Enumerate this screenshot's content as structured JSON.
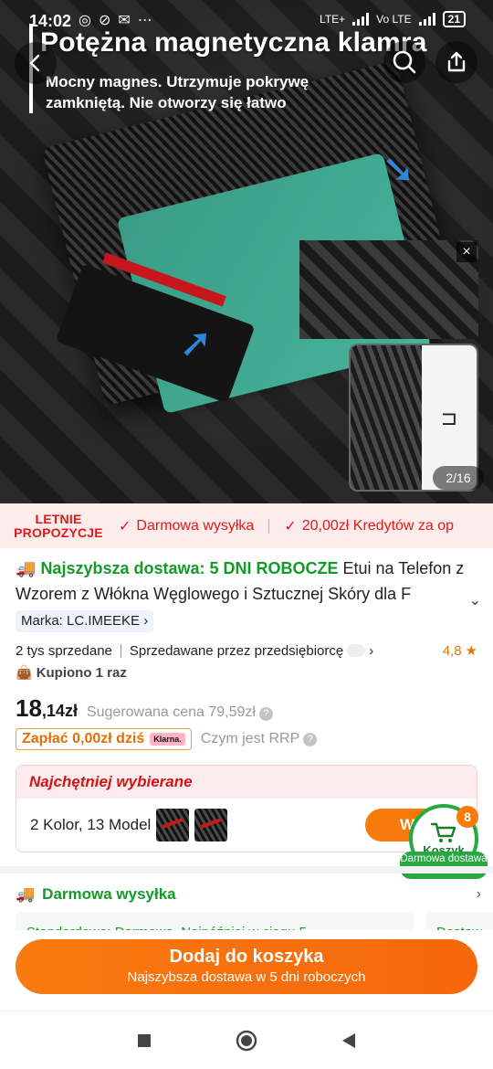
{
  "status_bar": {
    "time": "14:02",
    "battery": "21",
    "net_labels": [
      "LTE+",
      "Vo LTE"
    ]
  },
  "hero": {
    "title": "Potężna magnetyczna klamra",
    "subtitle": "Mocny magnes. Utrzymuje pokrywę zamkniętą. Nie otworzy się łatwo",
    "image_counter": "2/16",
    "close_symbol": "×"
  },
  "promo": {
    "badge_line1": "LETNIE",
    "badge_line2": "PROPOZYCJE",
    "items": [
      "Darmowa wysyłka",
      "20,00zł Kredytów za op"
    ]
  },
  "product": {
    "fast_delivery": "Najszybsza dostawa: 5 DNI ROBOCZE",
    "title_rest": "Etui na Telefon z Wzorem z Włókna Węglowego i Sztucznej Skóry dla F",
    "brand": "Marka: LC.IMEEKE",
    "sold": "2 tys sprzedane",
    "seller": "Sprzedawane przez przedsiębiorcę",
    "rating": "4,8",
    "bought": "Kupiono 1 raz",
    "price_int": "18",
    "price_dec": ",14zł",
    "rrp": "Sugerowana cena 79,59zł",
    "klarna_text": "Zapłać 0,00zł dziś",
    "klarna_logo": "Klarna.",
    "rrp_question": "Czym jest RRP"
  },
  "choice": {
    "heading": "Najchętniej wybierane",
    "variants": "2 Kolor, 13 Model",
    "button": "Wyb"
  },
  "cart": {
    "count": "8",
    "label": "Koszyk",
    "tag": "Darmowa dostawa"
  },
  "shipping": {
    "title": "Darmowa wysyłka",
    "option1": "Standardowa: Darmowa, Najpóźniej w ciągu 5",
    "option2": "Dostaw"
  },
  "cta": {
    "main": "Dodaj do koszyka",
    "sub": "Najszybsza dostawa w 5 dni roboczych"
  },
  "colors": {
    "accent": "#f77a0b",
    "green": "#149a28",
    "red": "#e21919"
  }
}
